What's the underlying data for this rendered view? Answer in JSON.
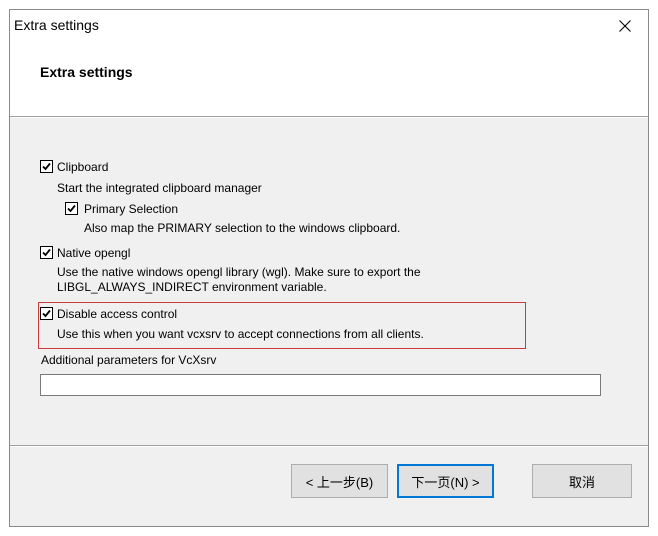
{
  "window": {
    "title": "Extra settings",
    "close_glyph": "✕"
  },
  "header": {
    "title": "Extra settings"
  },
  "options": {
    "clipboard": {
      "label": "Clipboard",
      "desc": "Start the integrated clipboard manager",
      "checked": true
    },
    "primary_selection": {
      "label": "Primary Selection",
      "desc": "Also map the PRIMARY selection to the windows clipboard.",
      "checked": true
    },
    "native_opengl": {
      "label": "Native opengl",
      "desc_line1": "Use the native windows opengl library (wgl). Make sure to export the",
      "desc_line2": "LIBGL_ALWAYS_INDIRECT environment variable.",
      "checked": true
    },
    "disable_access_control": {
      "label": "Disable access control",
      "desc": "Use this when you want vcxsrv to accept connections from all clients.",
      "checked": true
    }
  },
  "params": {
    "label": "Additional parameters for VcXsrv",
    "value": ""
  },
  "buttons": {
    "back": "< 上一步(B)",
    "next": "下一页(N) >",
    "cancel": "取消"
  },
  "colors": {
    "highlight_border": "#cc3a3a",
    "focus_border": "#0078d7"
  }
}
